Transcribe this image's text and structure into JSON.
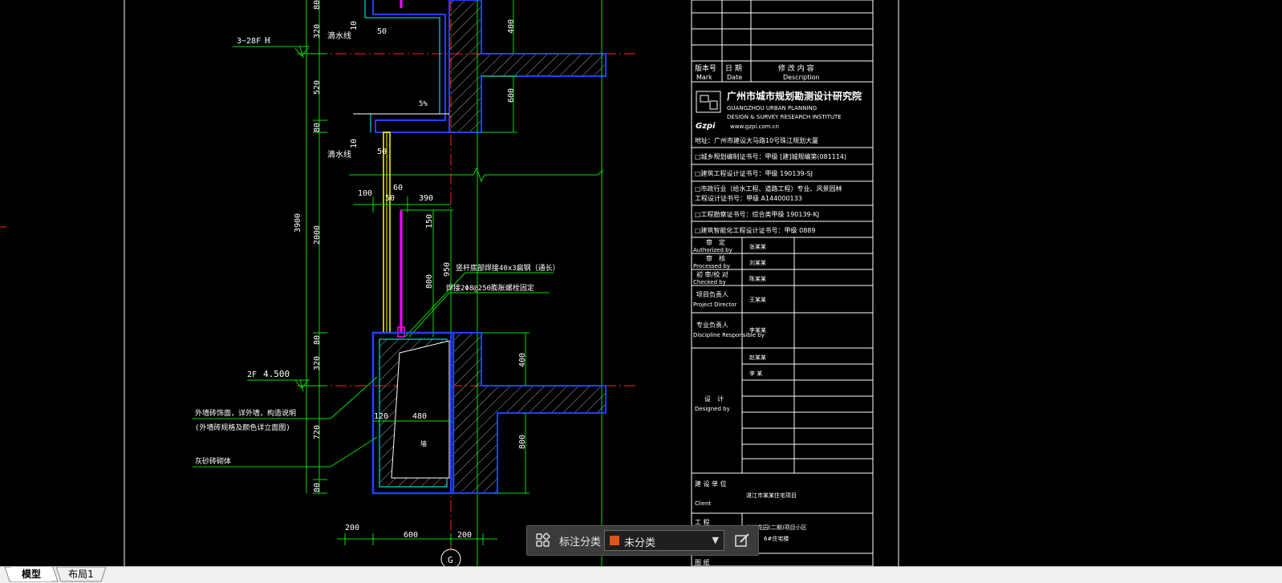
{
  "canvas": {
    "levels": {
      "upper": "3~28F",
      "upper_mark": "H",
      "lower": "2F",
      "lower_value": "4.500"
    },
    "left_dims": [
      "80",
      "320",
      "520",
      "80",
      "3900",
      "2000",
      "80",
      "320",
      "720",
      "80"
    ],
    "upper_section": {
      "drip_label": "滴水线",
      "dim_10": "10",
      "dim_50": "50",
      "dim_400": "400",
      "dim_600": "600",
      "slope": "5%"
    },
    "middle_section": {
      "drip_label": "滴水线",
      "dim_10": "10",
      "dim_50": "50"
    },
    "railing": {
      "dim_100": "100",
      "dim_60": "60",
      "dim_50": "50",
      "dim_390": "390",
      "dim_150": "150",
      "dim_950": "950",
      "dim_800": "800",
      "note1": "竖杆底部焊接40x3扁钢（通长）",
      "note2": "焊接2Φ8@250膨胀螺栓固定"
    },
    "lower_section": {
      "dim_400": "400",
      "dim_800": "800",
      "dim_120": "120",
      "dim_480": "480",
      "inner_label": "墙"
    },
    "notes": {
      "note_a": "外墙砖饰面，详外墙，构造说明",
      "note_b": "(外墙砖规格及颜色详立面图)",
      "note_c": "灰砂砖砌体"
    },
    "bottom_dims": {
      "d1": "200",
      "d2": "600",
      "d3": "200"
    },
    "axis": "G"
  },
  "titleblock": {
    "rev_header": {
      "mark_cn": "版本号",
      "mark_en": "Mark",
      "date_cn": "日 期",
      "date_en": "Date",
      "desc_cn": "修 改 内 容",
      "desc_en": "Description"
    },
    "company_cn": "广州市城市规划勘测设计研究院",
    "company_en1": "GUANGZHOU URBAN PLANNING",
    "company_en2": "DESIGN & SURVEY RESEARCH INSTITUTE",
    "logo_text": "Gzpi",
    "website": "www.gzpi.com.cn",
    "address": "地址：广州市建设大马路10号珠江规划大厦",
    "certs": [
      "□城乡规划编制证书号：甲级 [建]城规编第(081114)",
      "□建筑工程设计证书号：甲级 190139-SJ",
      "□市政行业（给水工程、道路工程）专业、风景园林",
      "  工程设计证书号：甲级 A144000133",
      "□工程勘察证书号：综合类甲级 190139-KJ",
      "□建筑智能化工程设计证书号：甲级 0889"
    ],
    "roles": [
      {
        "cn": "审　定",
        "en": "Authorized by",
        "name": "张某某"
      },
      {
        "cn": "审　核",
        "en": "Processed by",
        "name": "刘某某"
      },
      {
        "cn": "初 审/校 对",
        "en": "Checked by",
        "name": "陈某某"
      },
      {
        "cn": "项目负责人",
        "en": "Project Director",
        "name": "王某某"
      },
      {
        "cn": "专业负责人",
        "en": "Discipline Responsible by",
        "name": "李某某"
      }
    ],
    "designers": {
      "cn": "设　计",
      "en": "Designed by",
      "names": [
        "赵某某",
        "李 某"
      ]
    },
    "client": {
      "cn": "建 设 单 位",
      "en": "Client",
      "value": "湛江市某某住宅项目"
    },
    "project": {
      "cn": "工 程",
      "value": "某某花园(二期)项目小区",
      "sub": "6#住宅楼"
    },
    "drawing": {
      "cn": "图 纸"
    }
  },
  "annotation_toolbar": {
    "label": "标注分类",
    "selected": "未分类",
    "swatch_color": "#e0531b"
  },
  "layout_tabs": [
    {
      "label": "模型",
      "active": true
    },
    {
      "label": "布局1",
      "active": false
    }
  ],
  "colors": {
    "background": "#000000",
    "dim_green": "#00ff00",
    "axis_red": "#ff0000",
    "frame_white": "#ffffff",
    "wall_blue": "#2040ff",
    "hatch_white": "#ffffff",
    "glass_yellow": "#ffff00",
    "rail_magenta": "#ff00ff",
    "cyan": "#00ffff"
  }
}
